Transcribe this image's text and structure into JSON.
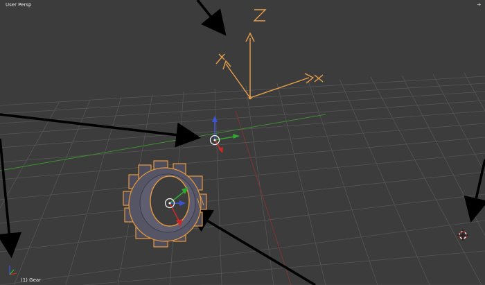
{
  "viewport": {
    "view_name": "User Persp",
    "active_object": "(1) Gear",
    "corner_widget_icon": "split-view-icon",
    "background_color": "#3c3c3c",
    "grid_color": "#555555",
    "x_axis_color": "#8b3434",
    "y_axis_color": "#3c8f2f",
    "selection_color": "#e89a3a",
    "camera_color": "#e8a04a"
  },
  "scene": {
    "camera_axis_label": "Z",
    "arrows_icon": "pointer-arrow-icon",
    "gear_icon": "gear-mesh-icon",
    "cursor_icon": "3d-cursor-icon"
  }
}
